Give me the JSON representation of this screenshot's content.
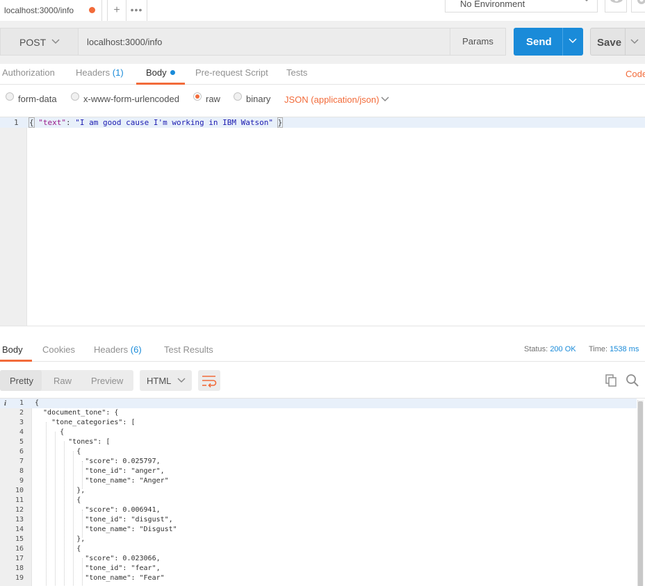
{
  "tab": {
    "title": "localhost:3000/info",
    "unsaved_color": "#f26b3a"
  },
  "new_tab_label": "+",
  "more_tabs_label": "•••",
  "environment": {
    "selected": "No Environment"
  },
  "request": {
    "method": "POST",
    "url": "localhost:3000/info",
    "params_label": "Params",
    "send_label": "Send",
    "save_label": "Save"
  },
  "request_tabs": [
    {
      "label": "Authorization"
    },
    {
      "label": "Headers",
      "count": "(1)"
    },
    {
      "label": "Body"
    },
    {
      "label": "Pre-request Script"
    },
    {
      "label": "Tests"
    }
  ],
  "code_link": "Code",
  "body_types": [
    {
      "label": "form-data",
      "checked": false
    },
    {
      "label": "x-www-form-urlencoded",
      "checked": false
    },
    {
      "label": "raw",
      "checked": true
    },
    {
      "label": "binary",
      "checked": false
    }
  ],
  "content_type": "JSON (application/json)",
  "request_body": {
    "line_number": "1",
    "open": "{",
    "key": "\"text\"",
    "colon": ": ",
    "value": "\"I am good cause I'm working in IBM Watson\"",
    "close": "}"
  },
  "response_tabs": [
    {
      "label": "Body"
    },
    {
      "label": "Cookies"
    },
    {
      "label": "Headers",
      "count": "(6)"
    },
    {
      "label": "Test Results"
    }
  ],
  "status": {
    "label": "Status:",
    "value": "200 OK"
  },
  "time": {
    "label": "Time:",
    "value": "1538 ms"
  },
  "view_modes": [
    "Pretty",
    "Raw",
    "Preview"
  ],
  "format": "HTML",
  "colors": {
    "accent": "#f26b3a",
    "primary": "#1a8bd9"
  },
  "response_lines": [
    {
      "n": "1",
      "t": "{"
    },
    {
      "n": "2",
      "t": "  \"document_tone\": {"
    },
    {
      "n": "3",
      "t": "    \"tone_categories\": ["
    },
    {
      "n": "4",
      "t": "      {"
    },
    {
      "n": "5",
      "t": "        \"tones\": ["
    },
    {
      "n": "6",
      "t": "          {"
    },
    {
      "n": "7",
      "t": "            \"score\": 0.025797,"
    },
    {
      "n": "8",
      "t": "            \"tone_id\": \"anger\","
    },
    {
      "n": "9",
      "t": "            \"tone_name\": \"Anger\""
    },
    {
      "n": "10",
      "t": "          },"
    },
    {
      "n": "11",
      "t": "          {"
    },
    {
      "n": "12",
      "t": "            \"score\": 0.006941,"
    },
    {
      "n": "13",
      "t": "            \"tone_id\": \"disgust\","
    },
    {
      "n": "14",
      "t": "            \"tone_name\": \"Disgust\""
    },
    {
      "n": "15",
      "t": "          },"
    },
    {
      "n": "16",
      "t": "          {"
    },
    {
      "n": "17",
      "t": "            \"score\": 0.023066,"
    },
    {
      "n": "18",
      "t": "            \"tone_id\": \"fear\","
    },
    {
      "n": "19",
      "t": "            \"tone_name\": \"Fear\""
    }
  ]
}
